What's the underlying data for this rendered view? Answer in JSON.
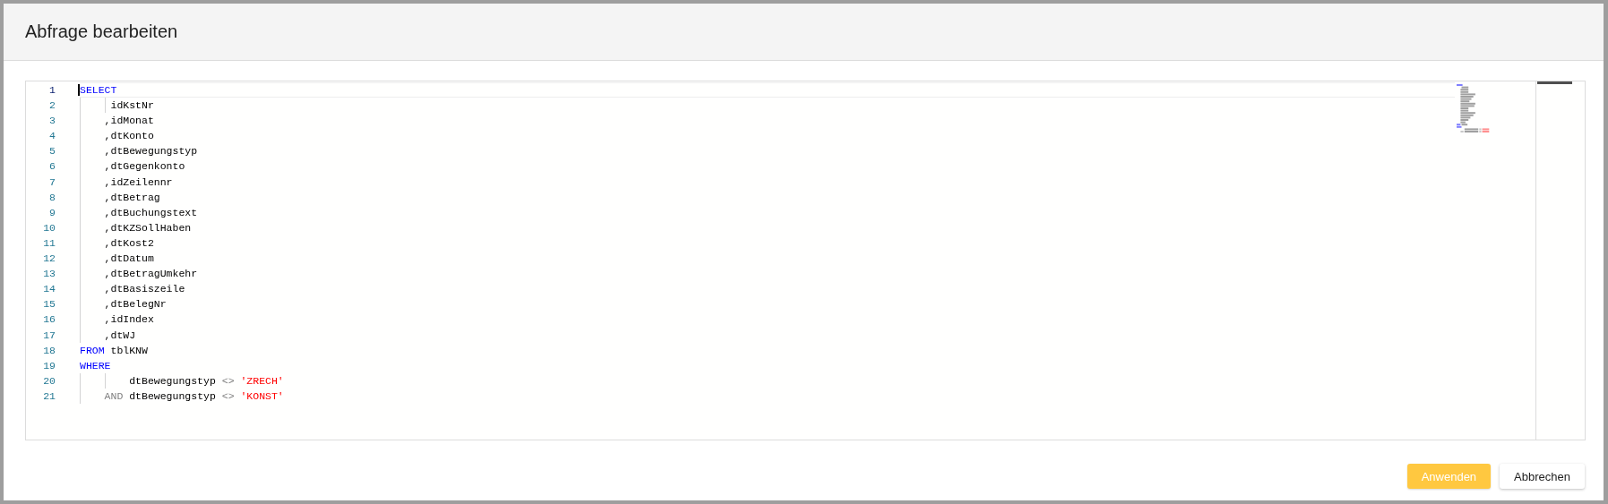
{
  "dialog": {
    "title": "Abfrage bearbeiten"
  },
  "editor": {
    "lines": [
      {
        "number": "1",
        "current": true,
        "tokens": [
          {
            "kind": "keyword",
            "text": "SELECT"
          }
        ]
      },
      {
        "number": "2",
        "current": false,
        "tokens": [
          {
            "kind": "ident",
            "text": "     idKstNr"
          }
        ]
      },
      {
        "number": "3",
        "current": false,
        "tokens": [
          {
            "kind": "ident",
            "text": "    ,idMonat"
          }
        ]
      },
      {
        "number": "4",
        "current": false,
        "tokens": [
          {
            "kind": "ident",
            "text": "    ,dtKonto"
          }
        ]
      },
      {
        "number": "5",
        "current": false,
        "tokens": [
          {
            "kind": "ident",
            "text": "    ,dtBewegungstyp"
          }
        ]
      },
      {
        "number": "6",
        "current": false,
        "tokens": [
          {
            "kind": "ident",
            "text": "    ,dtGegenkonto"
          }
        ]
      },
      {
        "number": "7",
        "current": false,
        "tokens": [
          {
            "kind": "ident",
            "text": "    ,idZeilennr"
          }
        ]
      },
      {
        "number": "8",
        "current": false,
        "tokens": [
          {
            "kind": "ident",
            "text": "    ,dtBetrag"
          }
        ]
      },
      {
        "number": "9",
        "current": false,
        "tokens": [
          {
            "kind": "ident",
            "text": "    ,dtBuchungstext"
          }
        ]
      },
      {
        "number": "10",
        "current": false,
        "tokens": [
          {
            "kind": "ident",
            "text": "    ,dtKZSollHaben"
          }
        ]
      },
      {
        "number": "11",
        "current": false,
        "tokens": [
          {
            "kind": "ident",
            "text": "    ,dtKost2"
          }
        ]
      },
      {
        "number": "12",
        "current": false,
        "tokens": [
          {
            "kind": "ident",
            "text": "    ,dtDatum"
          }
        ]
      },
      {
        "number": "13",
        "current": false,
        "tokens": [
          {
            "kind": "ident",
            "text": "    ,dtBetragUmkehr"
          }
        ]
      },
      {
        "number": "14",
        "current": false,
        "tokens": [
          {
            "kind": "ident",
            "text": "    ,dtBasiszeile"
          }
        ]
      },
      {
        "number": "15",
        "current": false,
        "tokens": [
          {
            "kind": "ident",
            "text": "    ,dtBelegNr"
          }
        ]
      },
      {
        "number": "16",
        "current": false,
        "tokens": [
          {
            "kind": "ident",
            "text": "    ,idIndex"
          }
        ]
      },
      {
        "number": "17",
        "current": false,
        "tokens": [
          {
            "kind": "ident",
            "text": "    ,dtWJ"
          }
        ]
      },
      {
        "number": "18",
        "current": false,
        "tokens": [
          {
            "kind": "keyword",
            "text": "FROM"
          },
          {
            "kind": "ident",
            "text": " tblKNW"
          }
        ]
      },
      {
        "number": "19",
        "current": false,
        "tokens": [
          {
            "kind": "keyword",
            "text": "WHERE"
          }
        ]
      },
      {
        "number": "20",
        "current": false,
        "tokens": [
          {
            "kind": "ident",
            "text": "        dtBewegungstyp"
          },
          {
            "kind": "operator",
            "text": " <>"
          },
          {
            "kind": "string",
            "text": " 'ZRECH'"
          }
        ]
      },
      {
        "number": "21",
        "current": false,
        "tokens": [
          {
            "kind": "operator",
            "text": "    AND"
          },
          {
            "kind": "ident",
            "text": " dtBewegungstyp"
          },
          {
            "kind": "operator",
            "text": " <>"
          },
          {
            "kind": "string",
            "text": " 'KONST'"
          }
        ]
      }
    ]
  },
  "buttons": [
    {
      "kind": "primary",
      "label": "Anwenden"
    },
    {
      "kind": "secondary",
      "label": "Abbrechen"
    }
  ]
}
